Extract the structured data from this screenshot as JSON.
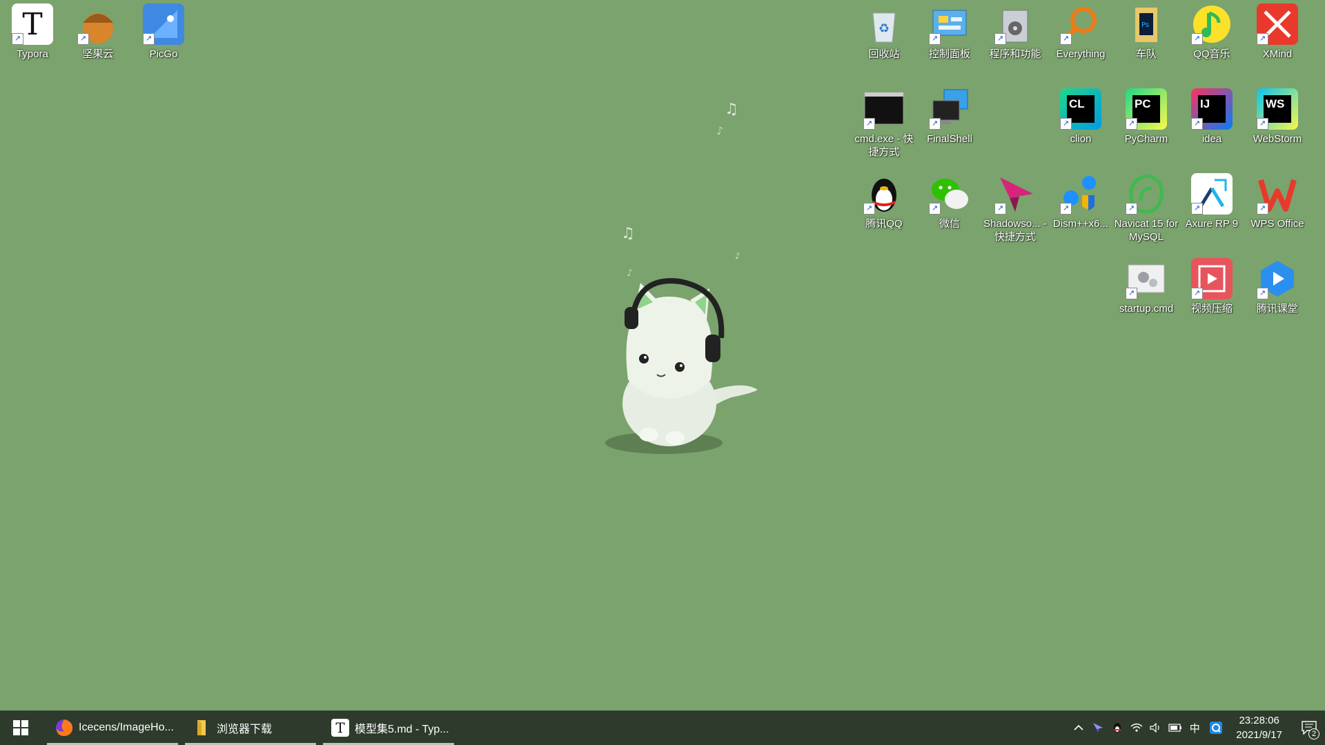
{
  "desktop": {
    "icons_left": [
      {
        "label": "Typora",
        "icon": "typora-icon"
      },
      {
        "label": "坚果云",
        "icon": "nutstore-icon"
      },
      {
        "label": "PicGo",
        "icon": "picgo-icon"
      }
    ],
    "row1": [
      {
        "label": "回收站",
        "icon": "recycle-bin-icon"
      },
      {
        "label": "控制面板",
        "icon": "control-panel-icon"
      },
      {
        "label": "程序和功能",
        "icon": "programs-features-icon"
      },
      {
        "label": "Everything",
        "icon": "everything-search-icon"
      },
      {
        "label": "车队",
        "icon": "photoshop-folder-icon"
      },
      {
        "label": "QQ音乐",
        "icon": "qq-music-icon"
      },
      {
        "label": "XMind",
        "icon": "xmind-icon"
      }
    ],
    "row2": [
      {
        "label": "cmd.exe - 快捷方式",
        "icon": "cmd-icon"
      },
      {
        "label": "FinalShell",
        "icon": "finalshell-icon"
      },
      {
        "label": "clion",
        "icon": "clion-icon",
        "letters": "CL"
      },
      {
        "label": "PyCharm",
        "icon": "pycharm-icon",
        "letters": "PC"
      },
      {
        "label": "idea",
        "icon": "idea-icon",
        "letters": "IJ"
      },
      {
        "label": "WebStorm",
        "icon": "webstorm-icon",
        "letters": "WS"
      }
    ],
    "row3": [
      {
        "label": "腾讯QQ",
        "icon": "qq-penguin-icon"
      },
      {
        "label": "微信",
        "icon": "wechat-icon"
      },
      {
        "label": "Shadowso... - 快捷方式",
        "icon": "shadowsocks-icon"
      },
      {
        "label": "Dism++x6...",
        "icon": "dism-gears-icon"
      },
      {
        "label": "Navicat 15 for MySQL",
        "icon": "navicat-icon"
      },
      {
        "label": "Axure RP 9",
        "icon": "axure-icon"
      },
      {
        "label": "WPS Office",
        "icon": "wps-icon"
      }
    ],
    "row4": [
      {
        "label": "startup.cmd",
        "icon": "cmd-gear-icon"
      },
      {
        "label": "视频压缩",
        "icon": "video-compress-icon"
      },
      {
        "label": "腾讯课堂",
        "icon": "tencent-classroom-icon"
      }
    ],
    "wallpaper": "cat-with-headphones"
  },
  "taskbar": {
    "apps": [
      {
        "label": "Icecens/ImageHo...",
        "icon": "firefox-icon"
      },
      {
        "label": "浏览器下载",
        "icon": "folder-icon"
      },
      {
        "label": "模型集5.md - Typ...",
        "icon": "typora-icon"
      }
    ],
    "ime": "中",
    "time": "23:28:06",
    "date": "2021/9/17",
    "notification_count": "2"
  },
  "colors": {
    "background": "#7ba36d",
    "taskbar": "#2e3b2c"
  }
}
